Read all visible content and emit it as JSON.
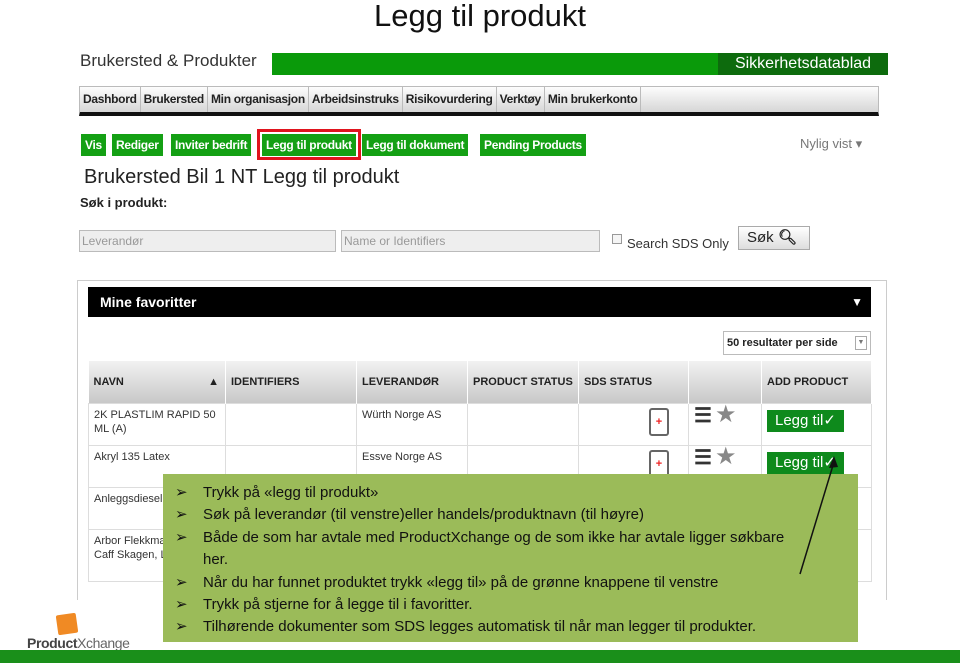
{
  "slide": {
    "title": "Legg til produkt"
  },
  "app": {
    "title": "Brukersted & Produkter",
    "sds_tab": "Sikkerhetsdatablad"
  },
  "nav": [
    "Dashbord",
    "Brukersted",
    "Min organisasjon",
    "Arbeidsinstruks",
    "Risikovurdering",
    "Verktøy",
    "Min brukerkonto"
  ],
  "actions": {
    "vis": "Vis",
    "rediger": "Rediger",
    "inviter": "Inviter bedrift",
    "legg_produkt": "Legg til produkt",
    "legg_dokument": "Legg til dokument",
    "pending": "Pending Products",
    "recent": "Nylig vist ▾"
  },
  "page": {
    "heading": "Brukersted Bil 1 NT Legg til produkt",
    "search_label": "Søk i produkt:"
  },
  "search": {
    "supplier_placeholder": "Leverandør",
    "name_placeholder": "Name or Identifiers",
    "sds_only": "Search SDS Only",
    "button": "Søk"
  },
  "favorites": {
    "title": "Mine favoritter",
    "per_page": "50 resultater per side",
    "columns": [
      "NAVN",
      "IDENTIFIERS",
      "LEVERANDØR",
      "PRODUCT STATUS",
      "SDS STATUS",
      "",
      "ADD PRODUCT"
    ],
    "rows": [
      {
        "name": "2K PLASTLIM RAPID 50 ML (A)",
        "supplier": "Würth Norge AS",
        "add": "Legg til✓"
      },
      {
        "name": "Akryl 135 Latex",
        "supplier": "Essve Norge AS",
        "add": "Legg til✓"
      },
      {
        "name": "Anleggsdiesel",
        "supplier": "",
        "add": ""
      },
      {
        "name": "Arbor Flekkma Eggehvit, Caff Skagen, Lys T",
        "supplier": "",
        "add": ""
      }
    ]
  },
  "callout": [
    "Trykk på «legg til produkt»",
    "Søk på leverandør (til venstre)eller handels/produktnavn (til høyre)",
    "Både de som har avtale med ProductXchange og de som ikke har avtale ligger søkbare her.",
    "Når du har funnet produktet trykk «legg til» på de grønne knappene til venstre",
    "Trykk på stjerne for å legge til i favoritter.",
    "Tilhørende dokumenter som SDS legges automatisk til når man legger til produkter."
  ],
  "logo": {
    "text_bold": "Product",
    "text_light": "Xchange"
  },
  "colors": {
    "green": "#14a014",
    "dark_green": "#0d6b0d",
    "callout": "#9bbb59",
    "highlight": "#e0141e"
  }
}
